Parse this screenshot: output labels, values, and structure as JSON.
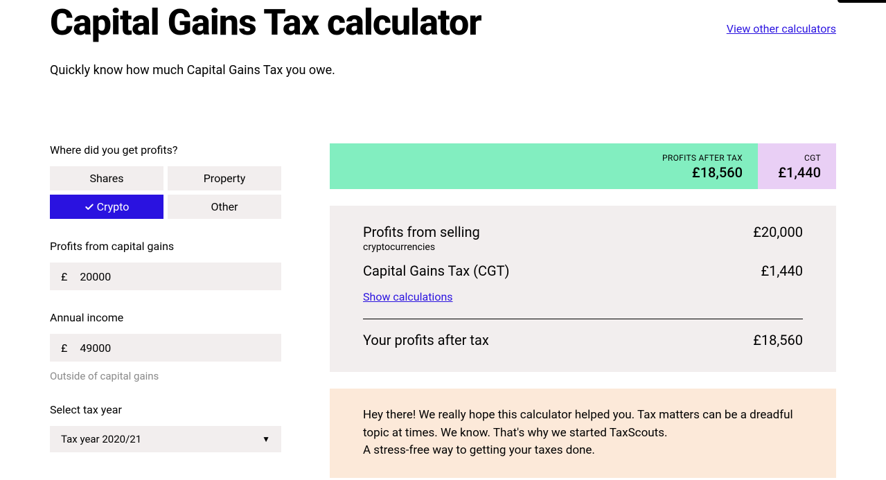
{
  "header": {
    "title": "Capital Gains Tax calculator",
    "other_link": "View other calculators",
    "subtitle": "Quickly know how much Capital Gains Tax you owe."
  },
  "form": {
    "profits_source": {
      "label": "Where did you get profits?",
      "options": {
        "shares": "Shares",
        "property": "Property",
        "crypto": "Crypto",
        "other": "Other"
      },
      "selected": "crypto"
    },
    "profits_amount": {
      "label": "Profits from capital gains",
      "currency": "£",
      "value": "20000"
    },
    "annual_income": {
      "label": "Annual income",
      "currency": "£",
      "value": "49000",
      "helper": "Outside of capital gains"
    },
    "tax_year": {
      "label": "Select tax year",
      "value": "Tax year 2020/21"
    }
  },
  "summary": {
    "profits_after_tax_label": "PROFITS AFTER TAX",
    "profits_after_tax_value": "£18,560",
    "cgt_label": "CGT",
    "cgt_value": "£1,440"
  },
  "results": {
    "row1_label": "Profits from selling",
    "row1_sub": "cryptocurrencies",
    "row1_value": "£20,000",
    "row2_label": "Capital Gains Tax (CGT)",
    "row2_value": "£1,440",
    "show_calc": "Show calculations",
    "row3_label": "Your profits after tax",
    "row3_value": "£18,560"
  },
  "promo": {
    "line1": "Hey there! We really hope this calculator helped you. Tax matters can be a dreadful topic at times. We know. That's why we started TaxScouts.",
    "line2": "A stress-free way to getting your taxes done."
  }
}
